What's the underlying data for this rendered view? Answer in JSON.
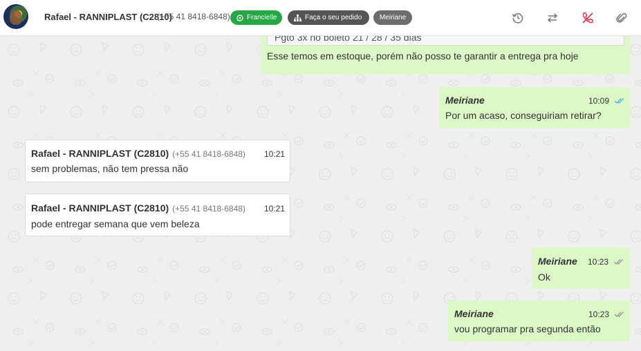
{
  "header": {
    "contact_name": "Rafael - RANNIPLAST (C2810)",
    "contact_phone": "(+55 41 8418-6848)",
    "tags": [
      {
        "label": "Francielle",
        "icon": "whatsapp-icon",
        "color": "#25a745"
      },
      {
        "label": "Faça o seu pedido",
        "icon": "sitemap-icon",
        "color": "#555555"
      },
      {
        "label": "Meiriane",
        "icon": "",
        "color": "#6c6c6c"
      }
    ],
    "actions": [
      "history-icon",
      "transfer-icon",
      "hangup-icon",
      "attach-icon"
    ]
  },
  "messages": [
    {
      "direction": "out",
      "quoted_text": "Pgto 3x no boleto 21 / 28 / 35 dias",
      "text": "Esse temos em estoque, porém não posso te garantir a entrega pra hoje"
    },
    {
      "direction": "out",
      "sender": "Meiriane",
      "time": "10:09",
      "status": "read",
      "text": "Por um acaso, conseguiriam retirar?"
    },
    {
      "direction": "in",
      "sender": "Rafael - RANNIPLAST (C2810)",
      "phone": "(+55 41 8418-6848)",
      "time": "10:21",
      "text": "sem problemas, não tem pressa não"
    },
    {
      "direction": "in",
      "sender": "Rafael - RANNIPLAST (C2810)",
      "phone": "(+55 41 8418-6848)",
      "time": "10:21",
      "text": "pode entregar semana que vem beleza"
    },
    {
      "direction": "out",
      "sender": "Meiriane",
      "time": "10:23",
      "status": "delivered",
      "text": "Ok"
    },
    {
      "direction": "out",
      "sender": "Meiriane",
      "time": "10:23",
      "status": "delivered",
      "text": "vou programar pra segunda então"
    }
  ],
  "colors": {
    "outgoing_bubble": "#dcf8c6",
    "incoming_bubble": "#ffffff",
    "read_ticks": "#4fb3e8",
    "delivered_ticks": "#9a9a9a",
    "hangup": "#d9344a"
  }
}
